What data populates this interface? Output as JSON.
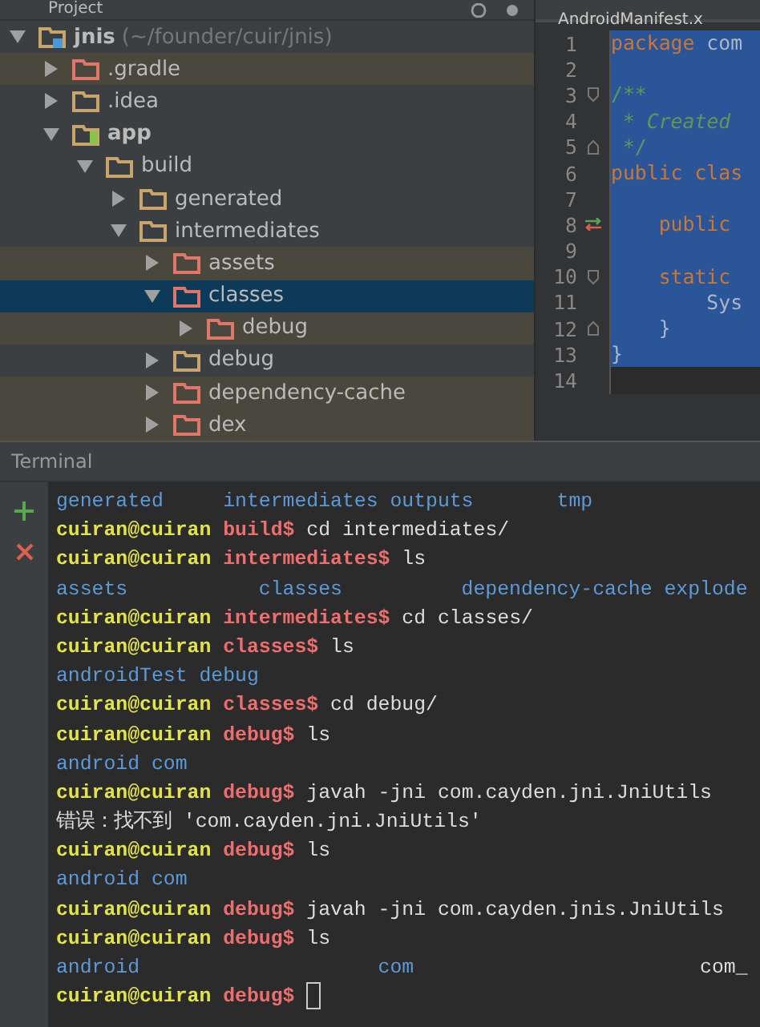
{
  "project_panel": {
    "title": "Project",
    "tree": [
      {
        "label": "jnis",
        "kind": "project",
        "path": "(~/founder/cuir/jnis)",
        "expanded": true,
        "selected": false,
        "excluded": false,
        "children": [
          {
            "label": ".gradle",
            "kind": "folder",
            "expanded": false,
            "selected": false,
            "excluded": true
          },
          {
            "label": ".idea",
            "kind": "folder",
            "expanded": false,
            "selected": false,
            "excluded": false
          },
          {
            "label": "app",
            "kind": "module",
            "expanded": true,
            "selected": false,
            "excluded": false,
            "children": [
              {
                "label": "build",
                "kind": "folder",
                "expanded": true,
                "selected": false,
                "excluded": false,
                "children": [
                  {
                    "label": "generated",
                    "kind": "folder",
                    "expanded": false,
                    "selected": false,
                    "excluded": false
                  },
                  {
                    "label": "intermediates",
                    "kind": "folder",
                    "expanded": true,
                    "selected": false,
                    "excluded": false,
                    "children": [
                      {
                        "label": "assets",
                        "kind": "folder",
                        "expanded": false,
                        "selected": false,
                        "excluded": true
                      },
                      {
                        "label": "classes",
                        "kind": "folder",
                        "expanded": true,
                        "selected": true,
                        "excluded": true,
                        "children": [
                          {
                            "label": "debug",
                            "kind": "folder",
                            "expanded": false,
                            "selected": false,
                            "excluded": true
                          }
                        ]
                      },
                      {
                        "label": "debug",
                        "kind": "folder",
                        "expanded": false,
                        "selected": false,
                        "excluded": false
                      },
                      {
                        "label": "dependency-cache",
                        "kind": "folder",
                        "expanded": false,
                        "selected": false,
                        "excluded": true
                      },
                      {
                        "label": "dex",
                        "kind": "folder",
                        "expanded": false,
                        "selected": false,
                        "excluded": true
                      }
                    ]
                  }
                ]
              }
            ]
          }
        ]
      }
    ]
  },
  "editor": {
    "tab": "AndroidManifest.x",
    "lines": [
      {
        "number": "1",
        "kind": "plain",
        "segments": [
          {
            "kind": "keyword",
            "text": "package"
          },
          {
            "kind": "plain",
            "text": " com"
          }
        ],
        "selected": true
      },
      {
        "number": "2",
        "kind": "plain",
        "selected": true
      },
      {
        "number": "3",
        "kind": "fold-start",
        "segments": [
          {
            "kind": "comment",
            "text": "/**"
          }
        ],
        "selected": true
      },
      {
        "number": "4",
        "kind": "plain",
        "segments": [
          {
            "kind": "comment",
            "text": " * "
          },
          {
            "kind": "comment-italic",
            "text": "Created"
          }
        ],
        "selected": true
      },
      {
        "number": "5",
        "kind": "fold-end",
        "segments": [
          {
            "kind": "comment",
            "text": " */"
          }
        ],
        "selected": true
      },
      {
        "number": "6",
        "kind": "plain",
        "segments": [
          {
            "kind": "keyword",
            "text": "public clas"
          }
        ],
        "selected": true
      },
      {
        "number": "7",
        "kind": "plain",
        "selected": true
      },
      {
        "number": "8",
        "kind": "override",
        "segments": [
          {
            "kind": "keyword",
            "text": "    public"
          }
        ],
        "selected": true
      },
      {
        "number": "9",
        "kind": "plain",
        "selected": true
      },
      {
        "number": "10",
        "kind": "fold-start",
        "segments": [
          {
            "kind": "keyword",
            "text": "    static"
          }
        ],
        "selected": true
      },
      {
        "number": "11",
        "kind": "plain",
        "segments": [
          {
            "kind": "plain",
            "text": "        Sys"
          }
        ],
        "selected": true
      },
      {
        "number": "12",
        "kind": "fold-end",
        "segments": [
          {
            "kind": "plain",
            "text": "    }"
          }
        ],
        "selected": true
      },
      {
        "number": "13",
        "kind": "plain",
        "segments": [
          {
            "kind": "plain",
            "text": "}"
          }
        ],
        "selected": true
      },
      {
        "number": "14",
        "kind": "plain",
        "selected": false
      }
    ]
  },
  "terminal": {
    "title": "Terminal",
    "lines": [
      {
        "kind": "output",
        "text": "generated     intermediates outputs       tmp"
      },
      {
        "kind": "prompt",
        "user": "cuiran@cuiran",
        "dir": "build$",
        "command": "cd intermediates/"
      },
      {
        "kind": "prompt",
        "user": "cuiran@cuiran",
        "dir": "intermediates$",
        "command": "ls"
      },
      {
        "kind": "output",
        "text": "assets           classes          dependency-cache explode"
      },
      {
        "kind": "prompt",
        "user": "cuiran@cuiran",
        "dir": "intermediates$",
        "command": "cd classes/"
      },
      {
        "kind": "prompt",
        "user": "cuiran@cuiran",
        "dir": "classes$",
        "command": "ls"
      },
      {
        "kind": "output",
        "text": "androidTest debug"
      },
      {
        "kind": "prompt",
        "user": "cuiran@cuiran",
        "dir": "classes$",
        "command": "cd debug/"
      },
      {
        "kind": "prompt",
        "user": "cuiran@cuiran",
        "dir": "debug$",
        "command": "ls"
      },
      {
        "kind": "output",
        "text": "android com"
      },
      {
        "kind": "prompt",
        "user": "cuiran@cuiran",
        "dir": "debug$",
        "command": "javah -jni com.cayden.jni.JniUtils"
      },
      {
        "kind": "message",
        "text": "错误：找不到 'com.cayden.jni.JniUtils'"
      },
      {
        "kind": "prompt",
        "user": "cuiran@cuiran",
        "dir": "debug$",
        "command": "ls"
      },
      {
        "kind": "output",
        "text": "android com"
      },
      {
        "kind": "prompt",
        "user": "cuiran@cuiran",
        "dir": "debug$",
        "command": "javah -jni com.cayden.jnis.JniUtils"
      },
      {
        "kind": "prompt",
        "user": "cuiran@cuiran",
        "dir": "debug$",
        "command": "ls"
      },
      {
        "kind": "output",
        "text": "android                    com                        ",
        "tail": "com_"
      },
      {
        "kind": "prompt",
        "user": "cuiran@cuiran",
        "dir": "debug$",
        "cursor": true
      }
    ]
  }
}
